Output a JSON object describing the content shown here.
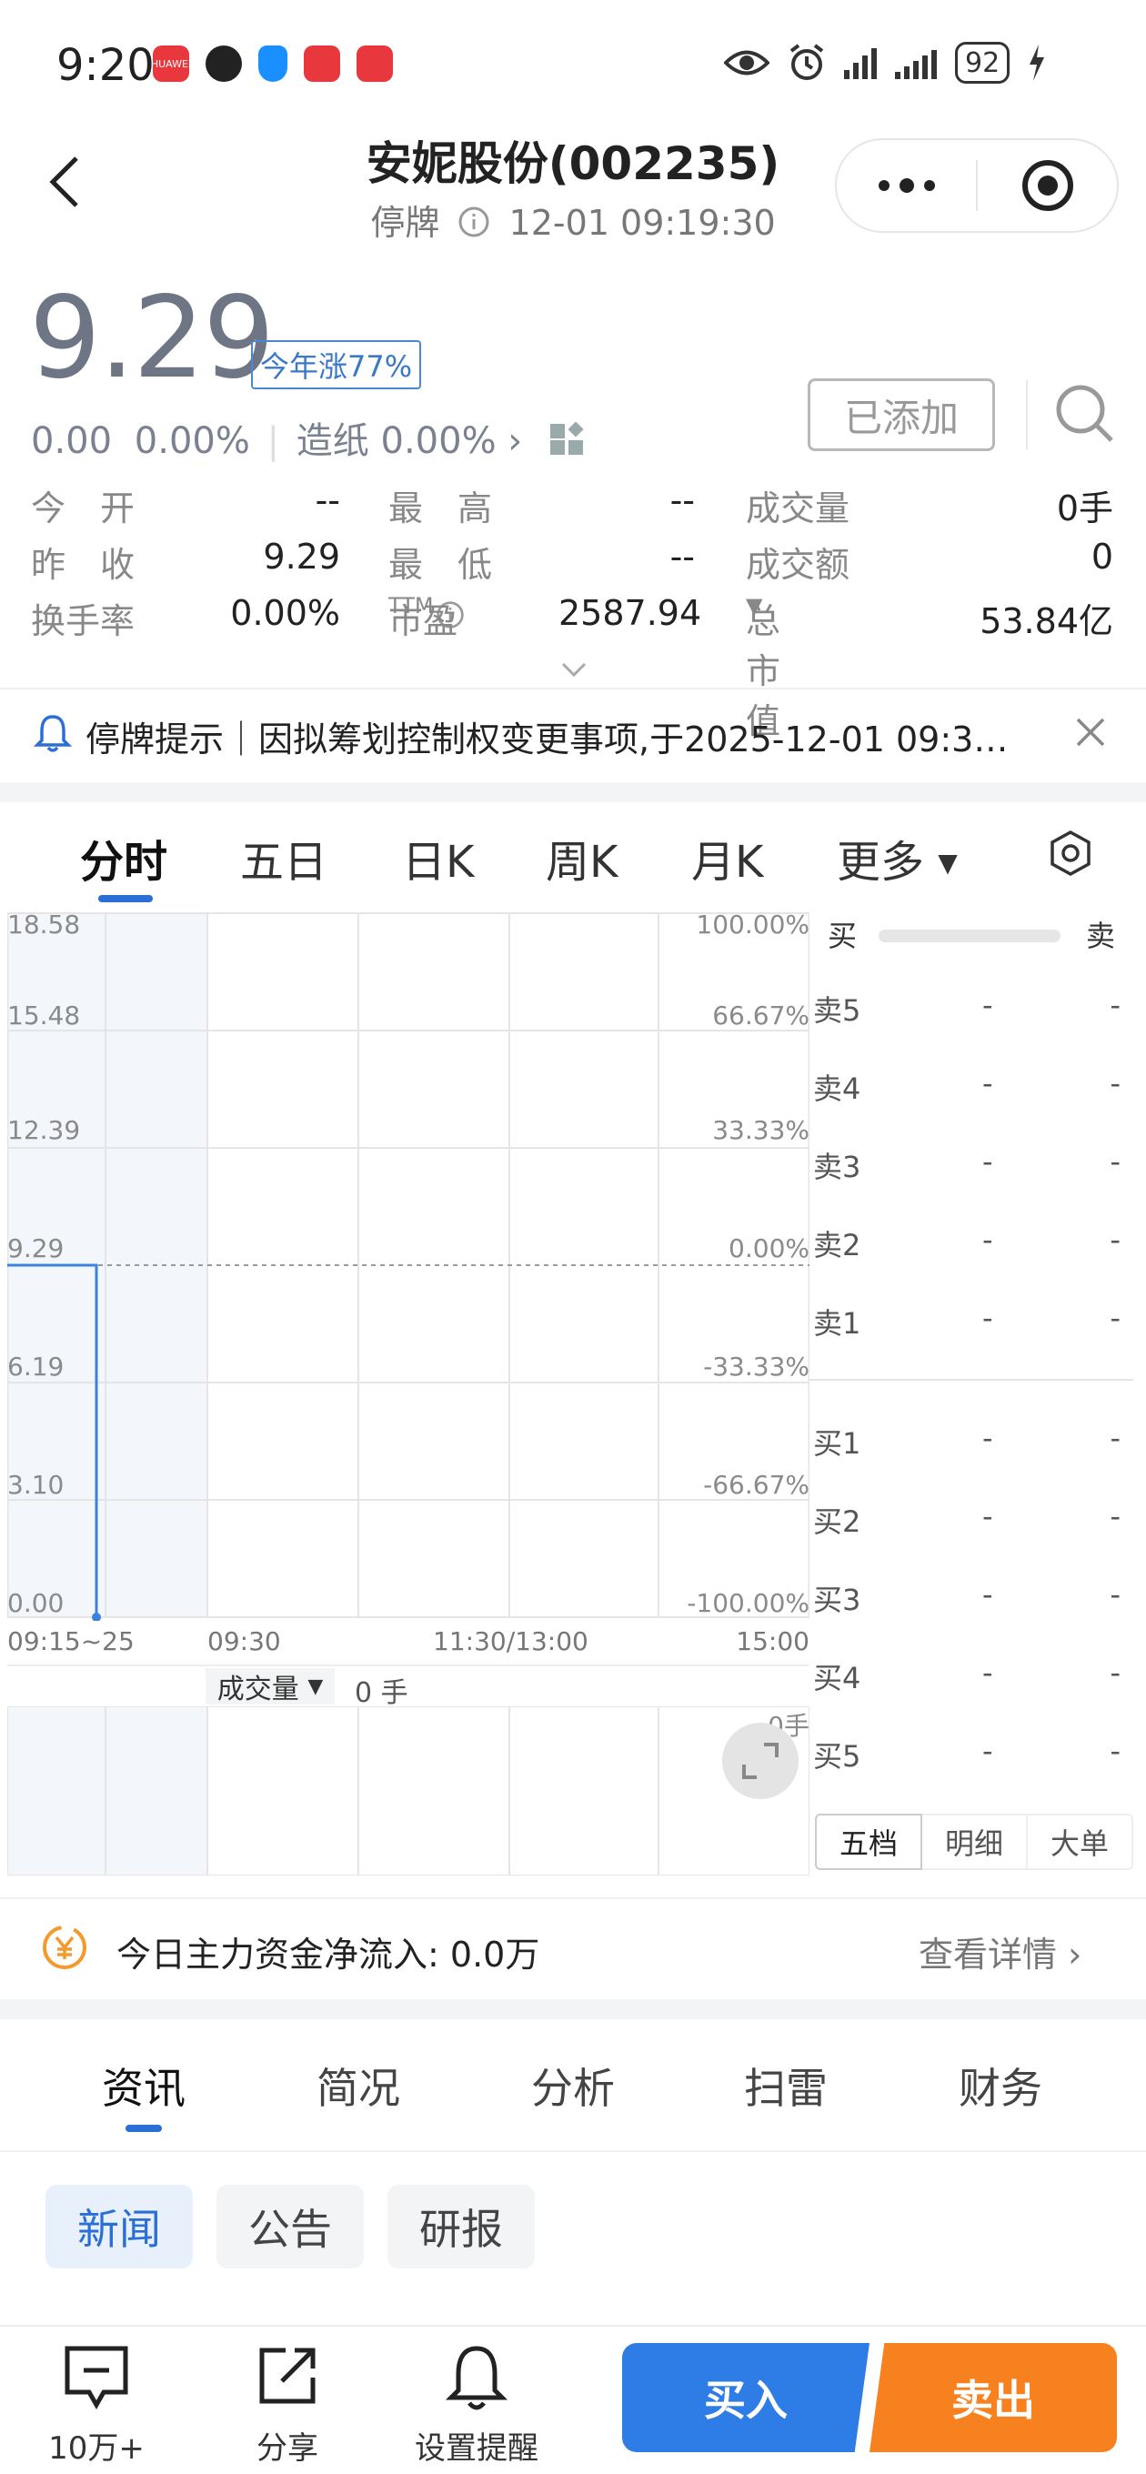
{
  "status_bar": {
    "time": "9:20",
    "battery": "92",
    "app_icon_huawei": "HUAWEI"
  },
  "header": {
    "title": "安妮股份(002235)",
    "status": "停牌",
    "timestamp": "12-01 09:19:30"
  },
  "quote": {
    "price": "9.29",
    "ytd": "今年涨77%",
    "change": "0.00",
    "change_pct": "0.00%",
    "sector": "造纸",
    "sector_pct": "0.00%",
    "added_label": "已添加"
  },
  "stats": [
    {
      "label": "今　开",
      "value": "--"
    },
    {
      "label": "最　高",
      "value": "--"
    },
    {
      "label": "成交量",
      "value": "0手"
    },
    {
      "label": "昨　收",
      "value": "9.29"
    },
    {
      "label": "最　低",
      "value": "--"
    },
    {
      "label": "成交额",
      "value": "0"
    },
    {
      "label": "换手率",
      "value": "0.00%"
    },
    {
      "label": "市盈",
      "value": "2587.94",
      "sup": "TTM"
    },
    {
      "label": "总市值",
      "value": "53.84亿"
    }
  ],
  "notice": {
    "text": "停牌提示｜因拟筹划控制权变更事项,于2025-12-01 09:3…"
  },
  "chart_tabs": [
    "分时",
    "五日",
    "日K",
    "周K",
    "月K",
    "更多"
  ],
  "chart_data": {
    "type": "line",
    "y_ticks_left": [
      "18.58",
      "15.48",
      "12.39",
      "9.29",
      "6.19",
      "3.10",
      "0.00"
    ],
    "y_ticks_right": [
      "100.00%",
      "66.67%",
      "33.33%",
      "0.00%",
      "-33.33%",
      "-66.67%",
      "-100.00%"
    ],
    "x_ticks": [
      "09:15~25",
      "09:30",
      "11:30/13:00",
      "15:00"
    ],
    "ylim": [
      0.0,
      18.58
    ],
    "reference_price": 9.29,
    "series": [
      {
        "values": [
          9.29,
          9.29,
          0.0
        ]
      }
    ],
    "volume_label": "成交量",
    "volume_value": "0 手",
    "volume_axis_max": "0手"
  },
  "orderbook": {
    "buy_label": "买",
    "sell_label": "卖",
    "sells": [
      {
        "label": "卖5",
        "price": "-",
        "vol": "-"
      },
      {
        "label": "卖4",
        "price": "-",
        "vol": "-"
      },
      {
        "label": "卖3",
        "price": "-",
        "vol": "-"
      },
      {
        "label": "卖2",
        "price": "-",
        "vol": "-"
      },
      {
        "label": "卖1",
        "price": "-",
        "vol": "-"
      }
    ],
    "buys": [
      {
        "label": "买1",
        "price": "-",
        "vol": "-"
      },
      {
        "label": "买2",
        "price": "-",
        "vol": "-"
      },
      {
        "label": "买3",
        "price": "-",
        "vol": "-"
      },
      {
        "label": "买4",
        "price": "-",
        "vol": "-"
      },
      {
        "label": "买5",
        "price": "-",
        "vol": "-"
      }
    ],
    "tabs": [
      "五档",
      "明细",
      "大单"
    ]
  },
  "fund_flow": {
    "label": "今日主力资金净流入:",
    "value": "0.0万",
    "link": "查看详情"
  },
  "info_tabs": [
    "资讯",
    "简况",
    "分析",
    "扫雷",
    "财务"
  ],
  "info_chips": [
    "新闻",
    "公告",
    "研报"
  ],
  "footer": {
    "comment_count": "10万+",
    "share": "分享",
    "alert": "设置提醒",
    "buy": "买入",
    "sell": "卖出"
  },
  "colors": {
    "accent": "#2b6fd6",
    "buy": "#2e7de6",
    "sell": "#f7801f",
    "price_gray": "#6e7686"
  }
}
